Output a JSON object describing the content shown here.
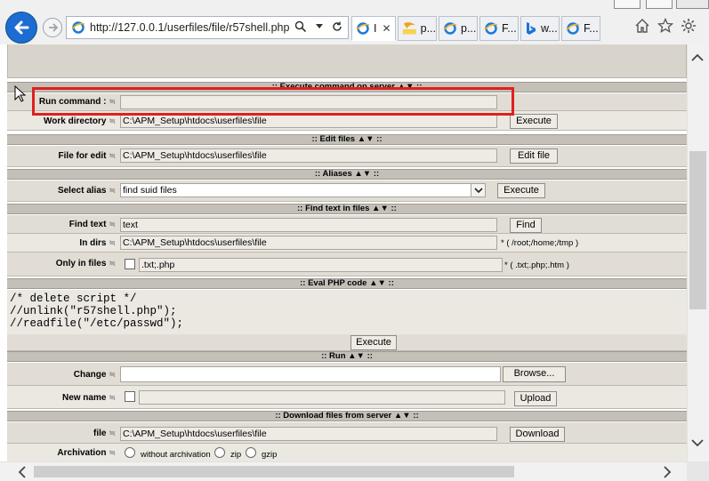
{
  "browser": {
    "url": "http://127.0.0.1/userfiles/file/r57shell.php",
    "tabs": [
      {
        "label": "I",
        "icon": "ie-icon",
        "active": true
      },
      {
        "label": "p...",
        "icon": "pma-icon"
      },
      {
        "label": "p...",
        "icon": "ie-icon"
      },
      {
        "label": "F...",
        "icon": "ie-icon"
      },
      {
        "label": "w...",
        "icon": "bing-icon"
      },
      {
        "label": "F...",
        "icon": "ie-icon"
      }
    ],
    "pma_badge": "PMA"
  },
  "sections": {
    "execute": ":: Execute command on server ▲▼ ::",
    "edit": ":: Edit files ▲▼ ::",
    "aliases": ":: Aliases ▲▼ ::",
    "find": ":: Find text in files ▲▼ ::",
    "eval": ":: Eval PHP code ▲▼ ::",
    "run": ":: Run ▲▼ ::",
    "download": ":: Download files from server ▲▼ ::"
  },
  "execute": {
    "run_label": "Run command :",
    "run_value": "",
    "workdir_label": "Work directory",
    "workdir_value": "C:\\APM_Setup\\htdocs\\userfiles\\file",
    "button": "Execute"
  },
  "edit": {
    "label": "File for edit",
    "value": "C:\\APM_Setup\\htdocs\\userfiles\\file",
    "button": "Edit file"
  },
  "aliases": {
    "label": "Select alias",
    "selected": "find suid files",
    "button": "Execute"
  },
  "find": {
    "text_label": "Find text",
    "text_value": "text",
    "button": "Find",
    "dirs_label": "In dirs",
    "dirs_value": "C:\\APM_Setup\\htdocs\\userfiles\\file",
    "dirs_note": "* ( /root;/home;/tmp )",
    "only_label": "Only in files",
    "only_value": ".txt;.php",
    "only_note": "* ( .txt;.php;.htm )"
  },
  "eval": {
    "code": "/* delete script */\n//unlink(\"r57shell.php\");\n//readfile(\"/etc/passwd\");",
    "button": "Execute"
  },
  "run": {
    "change_label": "Change",
    "change_value": "",
    "browse_button": "Browse...",
    "newname_label": "New name",
    "newname_value": "",
    "upload_button": "Upload"
  },
  "download": {
    "file_label": "file",
    "file_value": "C:\\APM_Setup\\htdocs\\userfiles\\file",
    "button": "Download",
    "archivation_label": "Archivation",
    "options": [
      "without archivation",
      "zip",
      "gzip"
    ]
  },
  "arrow_glyph": "≒"
}
